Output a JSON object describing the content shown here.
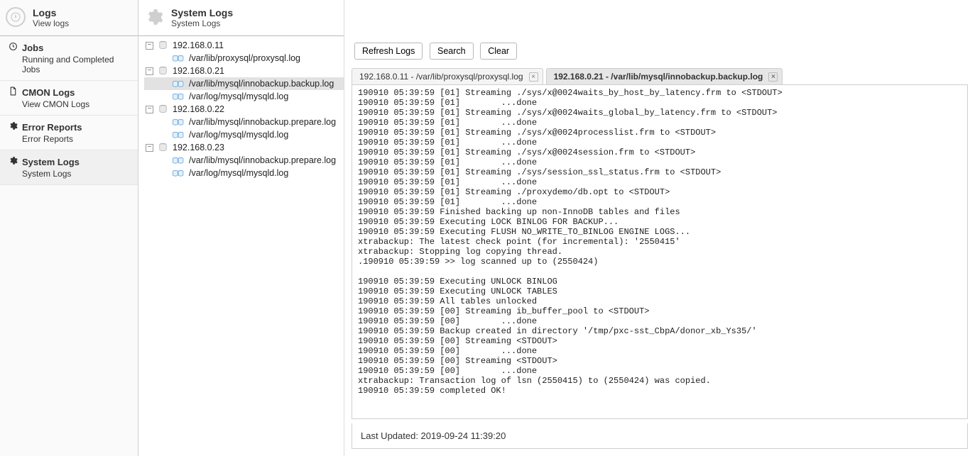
{
  "left_header": {
    "title": "Logs",
    "subtitle": "View logs"
  },
  "nav": [
    {
      "icon": "clock",
      "label": "Jobs",
      "desc": "Running and Completed Jobs"
    },
    {
      "icon": "file",
      "label": "CMON Logs",
      "desc": "View CMON Logs"
    },
    {
      "icon": "gear",
      "label": "Error Reports",
      "desc": "Error Reports"
    },
    {
      "icon": "gear",
      "label": "System Logs",
      "desc": "System Logs",
      "active": true
    }
  ],
  "tree_header": {
    "title": "System Logs",
    "subtitle": "System Logs"
  },
  "tree": [
    {
      "ip": "192.168.0.11",
      "files": [
        {
          "name": "/var/lib/proxysql/proxysql.log"
        }
      ]
    },
    {
      "ip": "192.168.0.21",
      "files": [
        {
          "name": "/var/lib/mysql/innobackup.backup.log",
          "selected": true
        },
        {
          "name": "/var/log/mysql/mysqld.log"
        }
      ]
    },
    {
      "ip": "192.168.0.22",
      "files": [
        {
          "name": "/var/lib/mysql/innobackup.prepare.log"
        },
        {
          "name": "/var/log/mysql/mysqld.log"
        }
      ]
    },
    {
      "ip": "192.168.0.23",
      "files": [
        {
          "name": "/var/lib/mysql/innobackup.prepare.log"
        },
        {
          "name": "/var/log/mysql/mysqld.log"
        }
      ]
    }
  ],
  "buttons": {
    "refresh": "Refresh Logs",
    "search": "Search",
    "clear": "Clear"
  },
  "tabs": [
    {
      "label": "192.168.0.11 - /var/lib/proxysql/proxysql.log"
    },
    {
      "label": "192.168.0.21 - /var/lib/mysql/innobackup.backup.log",
      "active": true
    }
  ],
  "log_lines": [
    "190910 05:39:59 [01] Streaming ./sys/x@0024waits_by_host_by_latency.frm to <STDOUT>",
    "190910 05:39:59 [01]        ...done",
    "190910 05:39:59 [01] Streaming ./sys/x@0024waits_global_by_latency.frm to <STDOUT>",
    "190910 05:39:59 [01]        ...done",
    "190910 05:39:59 [01] Streaming ./sys/x@0024processlist.frm to <STDOUT>",
    "190910 05:39:59 [01]        ...done",
    "190910 05:39:59 [01] Streaming ./sys/x@0024session.frm to <STDOUT>",
    "190910 05:39:59 [01]        ...done",
    "190910 05:39:59 [01] Streaming ./sys/session_ssl_status.frm to <STDOUT>",
    "190910 05:39:59 [01]        ...done",
    "190910 05:39:59 [01] Streaming ./proxydemo/db.opt to <STDOUT>",
    "190910 05:39:59 [01]        ...done",
    "190910 05:39:59 Finished backing up non-InnoDB tables and files",
    "190910 05:39:59 Executing LOCK BINLOG FOR BACKUP...",
    "190910 05:39:59 Executing FLUSH NO_WRITE_TO_BINLOG ENGINE LOGS...",
    "xtrabackup: The latest check point (for incremental): '2550415'",
    "xtrabackup: Stopping log copying thread.",
    ".190910 05:39:59 >> log scanned up to (2550424)",
    "",
    "190910 05:39:59 Executing UNLOCK BINLOG",
    "190910 05:39:59 Executing UNLOCK TABLES",
    "190910 05:39:59 All tables unlocked",
    "190910 05:39:59 [00] Streaming ib_buffer_pool to <STDOUT>",
    "190910 05:39:59 [00]        ...done",
    "190910 05:39:59 Backup created in directory '/tmp/pxc-sst_CbpA/donor_xb_Ys35/'",
    "190910 05:39:59 [00] Streaming <STDOUT>",
    "190910 05:39:59 [00]        ...done",
    "190910 05:39:59 [00] Streaming <STDOUT>",
    "190910 05:39:59 [00]        ...done",
    "xtrabackup: Transaction log of lsn (2550415) to (2550424) was copied.",
    "190910 05:39:59 completed OK!"
  ],
  "status": "Last Updated: 2019-09-24 11:39:20"
}
